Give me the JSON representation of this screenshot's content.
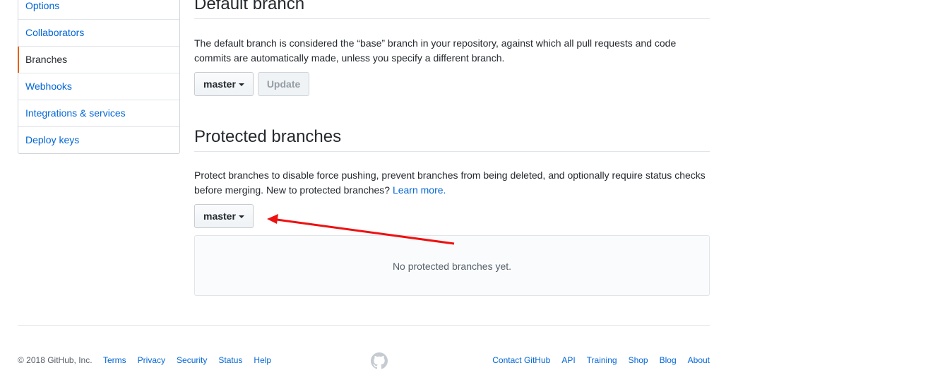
{
  "sidebar": {
    "items": [
      {
        "label": "Options"
      },
      {
        "label": "Collaborators"
      },
      {
        "label": "Branches"
      },
      {
        "label": "Webhooks"
      },
      {
        "label": "Integrations & services"
      },
      {
        "label": "Deploy keys"
      }
    ]
  },
  "default_branch": {
    "title": "Default branch",
    "description": "The default branch is considered the “base” branch in your repository, against which all pull requests and code commits are automatically made, unless you specify a different branch.",
    "branch_select": "master",
    "update_button": "Update"
  },
  "protected_branches": {
    "title": "Protected branches",
    "description": "Protect branches to disable force pushing, prevent branches from being deleted, and optionally require status checks before merging. New to protected branches?",
    "learn_more": "Learn more.",
    "branch_select": "master",
    "empty_message": "No protected branches yet."
  },
  "footer": {
    "copyright": "© 2018 GitHub, Inc.",
    "links_left": [
      "Terms",
      "Privacy",
      "Security",
      "Status",
      "Help"
    ],
    "links_right": [
      "Contact GitHub",
      "API",
      "Training",
      "Shop",
      "Blog",
      "About"
    ],
    "logo_icon": "github-mark-icon"
  },
  "annotation": {
    "color": "#ee1111"
  }
}
